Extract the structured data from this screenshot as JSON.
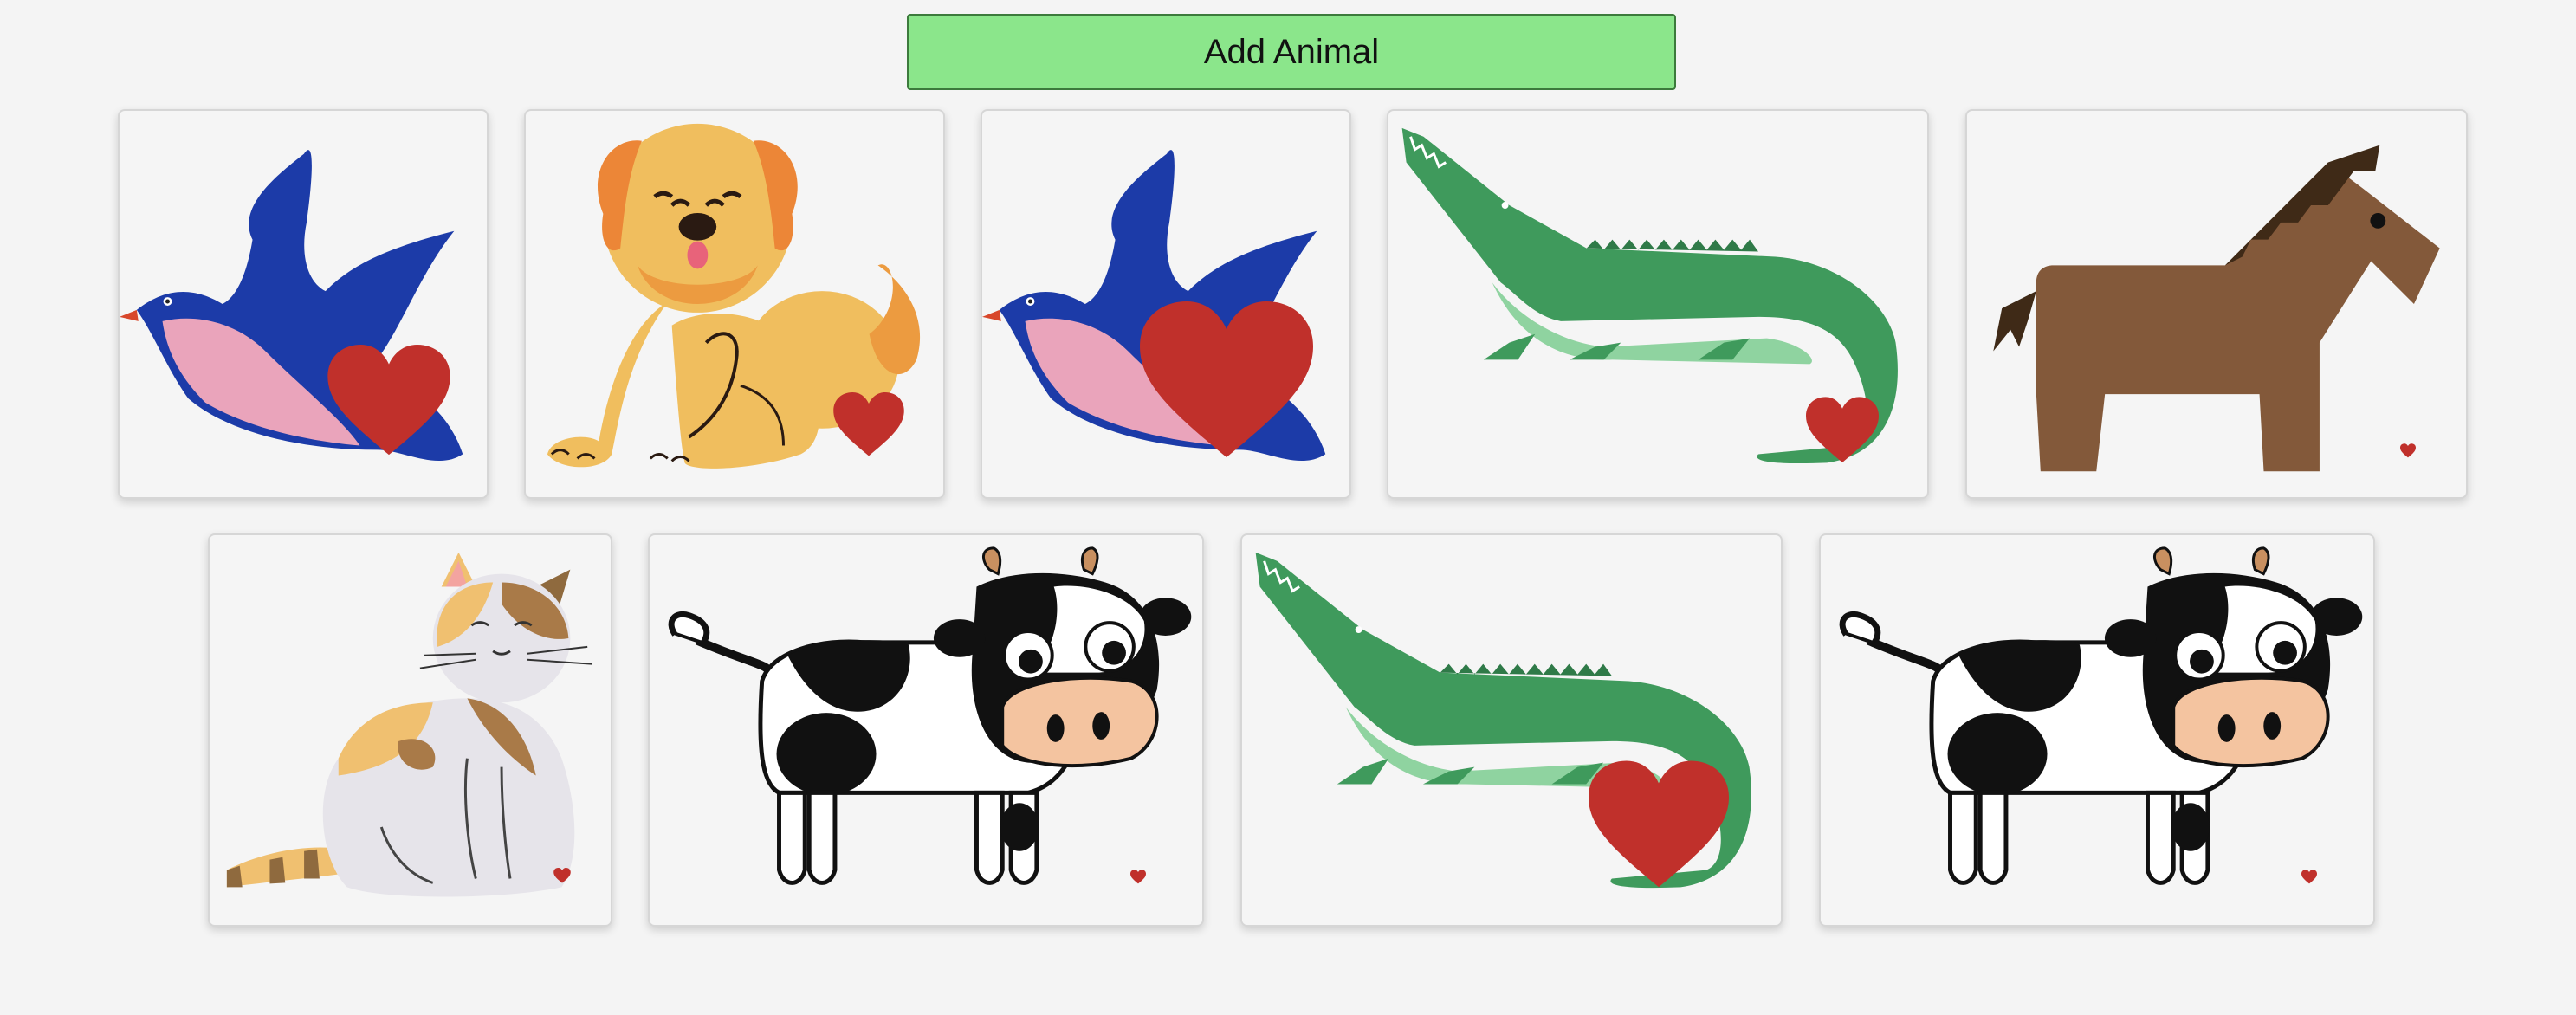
{
  "toolbar": {
    "add_label": "Add Animal"
  },
  "cards": [
    {
      "animal": "bird",
      "icon": "bird-icon",
      "favorite": true
    },
    {
      "animal": "dog",
      "icon": "dog-icon",
      "favorite": true
    },
    {
      "animal": "bird",
      "icon": "bird-icon",
      "favorite": true
    },
    {
      "animal": "crocodile",
      "icon": "crocodile-icon",
      "favorite": true
    },
    {
      "animal": "horse",
      "icon": "horse-icon",
      "favorite": true
    },
    {
      "animal": "cat",
      "icon": "cat-icon",
      "favorite": true
    },
    {
      "animal": "cow",
      "icon": "cow-icon",
      "favorite": true
    },
    {
      "animal": "crocodile",
      "icon": "crocodile-icon",
      "favorite": true
    },
    {
      "animal": "cow",
      "icon": "cow-icon",
      "favorite": true
    }
  ],
  "colors": {
    "button": "#8be68b",
    "heart": "#c0302b",
    "background": "#f4f4f4"
  }
}
